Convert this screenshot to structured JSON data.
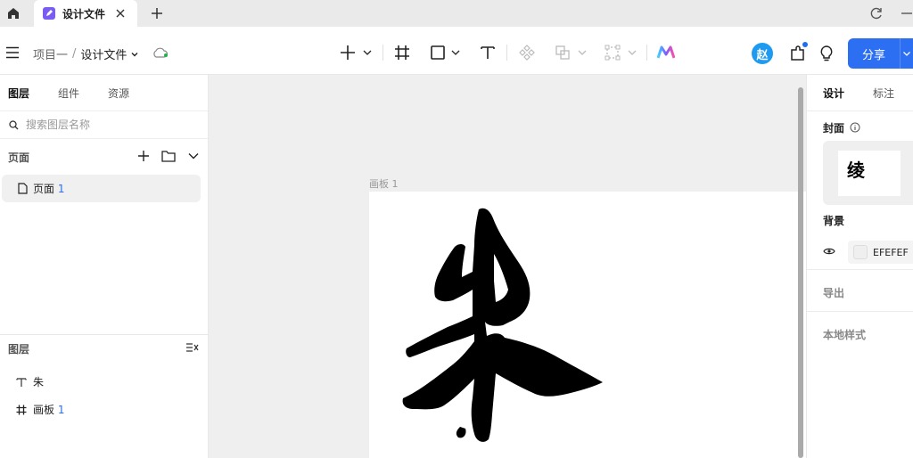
{
  "tabbar": {
    "tab_title": "设计文件"
  },
  "toolbar": {
    "project": "项目一",
    "separator": "/",
    "file": "设计文件",
    "avatar_initial": "赵",
    "share_label": "分享"
  },
  "left_panel": {
    "tabs": [
      {
        "label": "图层",
        "active": true
      },
      {
        "label": "组件",
        "active": false
      },
      {
        "label": "资源",
        "active": false
      }
    ],
    "search_placeholder": "搜索图层名称",
    "pages_header": "页面",
    "pages": [
      {
        "label": "页面",
        "number": "1"
      }
    ],
    "layers_header": "图层",
    "layers": [
      {
        "icon": "text-icon",
        "label": "朱",
        "number": ""
      },
      {
        "icon": "frame-icon",
        "label": "画板",
        "number": "1"
      }
    ]
  },
  "canvas": {
    "artboard_label": "画板 1",
    "character": "朱"
  },
  "right_panel": {
    "tabs": [
      {
        "label": "设计",
        "active": true
      },
      {
        "label": "标注",
        "active": false
      }
    ],
    "cover_title": "封面",
    "cover_glyph": "绫",
    "background_title": "背景",
    "background_color": "EFEFEF",
    "export_title": "导出",
    "local_styles_title": "本地样式"
  },
  "colors": {
    "accent": "#2d6ff3",
    "avatar": "#1e9bf0",
    "tab_icon": "#7b5cf0",
    "canvas_bg": "#EFEFEF"
  }
}
